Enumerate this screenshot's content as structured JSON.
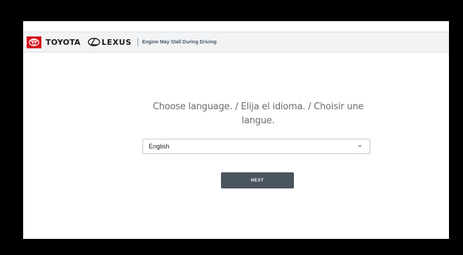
{
  "header": {
    "toyota_brand": "TOYOTA",
    "lexus_brand": "LEXUS",
    "campaign_title": "Engine May Stall During Driving"
  },
  "main": {
    "prompt": "Choose language. / Elija el idioma. / Choisir une langue.",
    "language_select": {
      "selected": "English"
    },
    "next_label": "NEXT"
  },
  "icons": {
    "toyota_logo": "toyota-emblem",
    "lexus_logo": "lexus-emblem",
    "select_caret": "chevron-down"
  },
  "colors": {
    "toyota_red": "#d4111d",
    "header_bg": "#f1f3f5",
    "button_bg": "#4b5560",
    "prompt_text": "#6b6b6b"
  }
}
